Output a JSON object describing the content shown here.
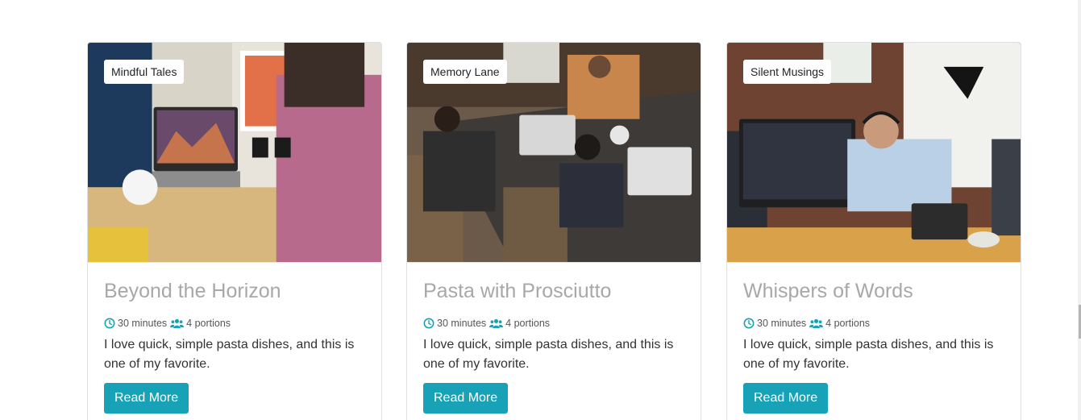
{
  "cards": [
    {
      "tag": "Mindful Tales",
      "title": "Beyond the Horizon",
      "time": "30 minutes",
      "portions": "4 portions",
      "description": "I love quick, simple pasta dishes, and this is one of my favorite.",
      "button": "Read More"
    },
    {
      "tag": "Memory Lane",
      "title": "Pasta with Prosciutto",
      "time": "30 minutes",
      "portions": "4 portions",
      "description": "I love quick, simple pasta dishes, and this is one of my favorite.",
      "button": "Read More"
    },
    {
      "tag": "Silent Musings",
      "title": "Whispers of Words",
      "time": "30 minutes",
      "portions": "4 portions",
      "description": "I love quick, simple pasta dishes, and this is one of my favorite.",
      "button": "Read More"
    }
  ],
  "icons": {
    "time": "clock-icon",
    "portions": "users-icon"
  },
  "colors": {
    "accent": "#17a2b8",
    "title": "#a8a8a8",
    "tag_bg": "#ffffff"
  }
}
